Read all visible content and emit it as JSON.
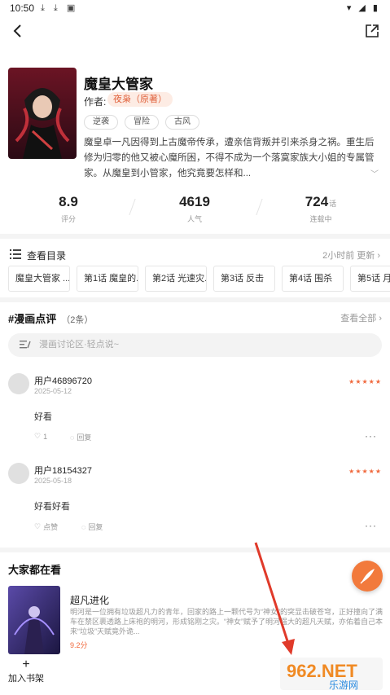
{
  "status_bar": {
    "time": "10:50"
  },
  "book": {
    "title": "魔皇大管家",
    "author_label": "作者:",
    "author": "夜枭（原著）",
    "tags": [
      "逆袭",
      "冒险",
      "古风"
    ],
    "description": "魔皇卓一凡因得到上古魔帝传承，遭亲信背叛并引来杀身之祸。重生后修为归零的他又被心魔所困，不得不成为一个落寞家族大小姐的专属管家。从魔皇到小管家，他究竟要怎样和..."
  },
  "stats": [
    {
      "value": "8.9",
      "unit": "",
      "label": "评分"
    },
    {
      "value": "4619",
      "unit": "",
      "label": "人气"
    },
    {
      "value": "724",
      "unit": "话",
      "label": "连载中"
    }
  ],
  "catalog": {
    "label": "查看目录",
    "update": "2小时前 更新",
    "chapters": [
      "魔皇大管家 ...",
      "第1话 魔皇的...",
      "第2话 光速灾...",
      "第3话 反击",
      "第4话 围杀",
      "第5话 月"
    ]
  },
  "comments_section": {
    "title": "#漫画点评",
    "count": "（2条）",
    "see_all": "查看全部",
    "placeholder": "漫画讨论区·轻点说~",
    "items": [
      {
        "user": "用户46896720",
        "date": "2025-05-12",
        "stars": "★★★★★",
        "text": "好看",
        "likes": "1",
        "reply": "回复"
      },
      {
        "user": "用户18154327",
        "date": "2025-05-18",
        "stars": "★★★★★",
        "text": "好看好看",
        "likes": "点赞",
        "reply": "回复"
      }
    ]
  },
  "recommend": {
    "title": "大家都在看",
    "items": [
      {
        "name": "超凡进化",
        "desc": "明河是一位拥有垃圾超凡力的青年，回家的路上一颗代号为“神女”的突显击破苍穹，正好撞向了满车在禁区裹透路上床袍的明河，形成铭刚之灾。“神女”赋予了明河强大的超凡天赋，亦佑着自己本来“垃圾”天赋竟外诡...",
        "score": "9.2分"
      }
    ]
  },
  "bottom": {
    "add_shelf": "加入书架"
  },
  "watermark": {
    "text": "962.NET",
    "sub": "乐游网"
  },
  "colors": {
    "accent": "#f0683c",
    "fab": "#f27a3c"
  }
}
